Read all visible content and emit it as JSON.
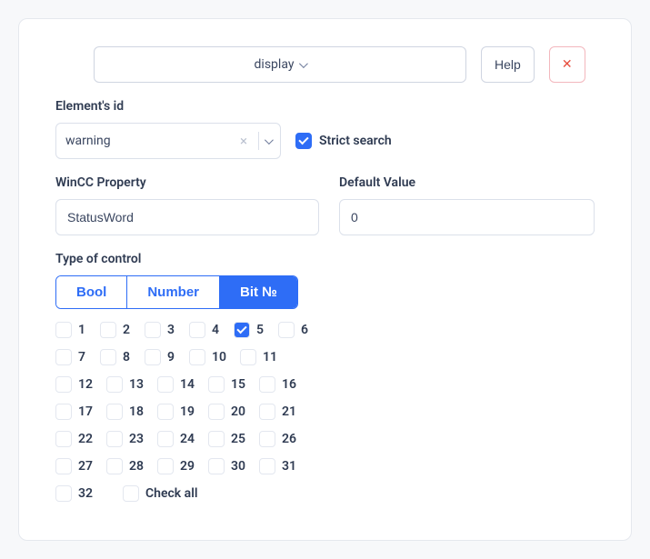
{
  "top": {
    "display_label": "display",
    "help_label": "Help",
    "close_icon": "✕"
  },
  "element_id": {
    "label": "Element's id",
    "value": "warning"
  },
  "strict_search": {
    "label": "Strict search",
    "checked": true
  },
  "wincc": {
    "label": "WinCC Property",
    "value": "StatusWord"
  },
  "default_value": {
    "label": "Default Value",
    "value": "0"
  },
  "type_of_control": {
    "label": "Type of control",
    "options": [
      "Bool",
      "Number",
      "Bit №"
    ],
    "active_index": 2
  },
  "bits": {
    "row1": [
      {
        "n": "1",
        "checked": false
      },
      {
        "n": "2",
        "checked": false
      },
      {
        "n": "3",
        "checked": false
      },
      {
        "n": "4",
        "checked": false
      },
      {
        "n": "5",
        "checked": true
      },
      {
        "n": "6",
        "checked": false
      }
    ],
    "row2": [
      {
        "n": "7",
        "checked": false
      },
      {
        "n": "8",
        "checked": false
      },
      {
        "n": "9",
        "checked": false
      },
      {
        "n": "10",
        "checked": false
      },
      {
        "n": "11",
        "checked": false
      }
    ],
    "rows_rest": [
      [
        {
          "n": "12"
        },
        {
          "n": "13"
        },
        {
          "n": "14"
        },
        {
          "n": "15"
        },
        {
          "n": "16"
        }
      ],
      [
        {
          "n": "17"
        },
        {
          "n": "18"
        },
        {
          "n": "19"
        },
        {
          "n": "20"
        },
        {
          "n": "21"
        }
      ],
      [
        {
          "n": "22"
        },
        {
          "n": "23"
        },
        {
          "n": "24"
        },
        {
          "n": "25"
        },
        {
          "n": "26"
        }
      ],
      [
        {
          "n": "27"
        },
        {
          "n": "28"
        },
        {
          "n": "29"
        },
        {
          "n": "30"
        },
        {
          "n": "31"
        }
      ]
    ],
    "last": {
      "n": "32"
    },
    "check_all_label": "Check all"
  }
}
